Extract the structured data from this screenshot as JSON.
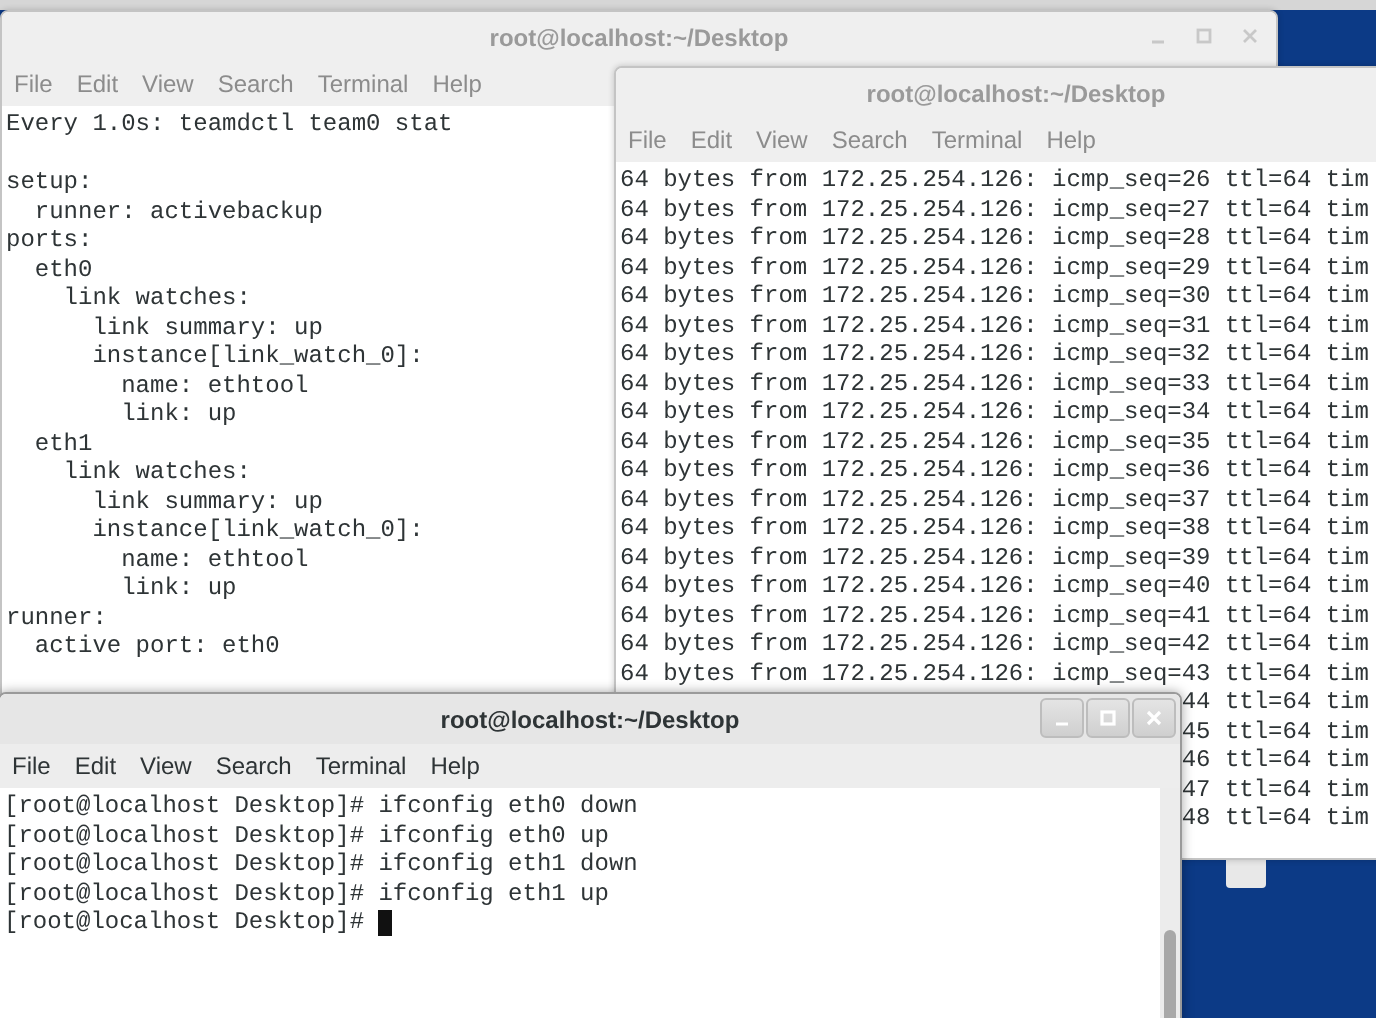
{
  "windows": [
    {
      "title": "root@localhost:~/Desktop",
      "active": false,
      "controls": [
        {
          "kind": "minimize"
        },
        {
          "kind": "maximize"
        },
        {
          "kind": "close"
        }
      ],
      "menu": [
        "File",
        "Edit",
        "View",
        "Search",
        "Terminal",
        "Help"
      ],
      "lines": [
        {
          "kind": "full",
          "text": "Every 1.0s: teamdctl team0 stat"
        },
        {
          "kind": "blank"
        },
        {
          "kind": "full",
          "text": "setup:"
        },
        {
          "kind": "full",
          "text": "  runner: activebackup"
        },
        {
          "kind": "full",
          "text": "ports:"
        },
        {
          "kind": "full",
          "text": "  eth0"
        },
        {
          "kind": "full",
          "text": "    link watches:"
        },
        {
          "kind": "full",
          "text": "      link summary: up"
        },
        {
          "kind": "full",
          "text": "      instance[link_watch_0]:"
        },
        {
          "kind": "full",
          "text": "        name: ethtool"
        },
        {
          "kind": "full",
          "text": "        link: up"
        },
        {
          "kind": "full",
          "text": "  eth1"
        },
        {
          "kind": "full",
          "text": "    link watches:"
        },
        {
          "kind": "full",
          "text": "      link summary: up"
        },
        {
          "kind": "full",
          "text": "      instance[link_watch_0]:"
        },
        {
          "kind": "full",
          "text": "        name: ethtool"
        },
        {
          "kind": "full",
          "text": "        link: up"
        },
        {
          "kind": "full",
          "text": "runner:"
        },
        {
          "kind": "full",
          "text": "  active port: eth0"
        }
      ],
      "cursor": false
    },
    {
      "title": "root@localhost:~/Desktop",
      "active": false,
      "menu": [
        "File",
        "Edit",
        "View",
        "Search",
        "Terminal",
        "Help"
      ],
      "lines": [
        {
          "kind": "full",
          "text": "64 bytes from 172.25.254.126: icmp_seq=26 ttl=64 tim"
        },
        {
          "kind": "full",
          "text": "64 bytes from 172.25.254.126: icmp_seq=27 ttl=64 tim"
        },
        {
          "kind": "full",
          "text": "64 bytes from 172.25.254.126: icmp_seq=28 ttl=64 tim"
        },
        {
          "kind": "full",
          "text": "64 bytes from 172.25.254.126: icmp_seq=29 ttl=64 tim"
        },
        {
          "kind": "full",
          "text": "64 bytes from 172.25.254.126: icmp_seq=30 ttl=64 tim"
        },
        {
          "kind": "full",
          "text": "64 bytes from 172.25.254.126: icmp_seq=31 ttl=64 tim"
        },
        {
          "kind": "full",
          "text": "64 bytes from 172.25.254.126: icmp_seq=32 ttl=64 tim"
        },
        {
          "kind": "full",
          "text": "64 bytes from 172.25.254.126: icmp_seq=33 ttl=64 tim"
        },
        {
          "kind": "full",
          "text": "64 bytes from 172.25.254.126: icmp_seq=34 ttl=64 tim"
        },
        {
          "kind": "full",
          "text": "64 bytes from 172.25.254.126: icmp_seq=35 ttl=64 tim"
        },
        {
          "kind": "full",
          "text": "64 bytes from 172.25.254.126: icmp_seq=36 ttl=64 tim"
        },
        {
          "kind": "full",
          "text": "64 bytes from 172.25.254.126: icmp_seq=37 ttl=64 tim"
        },
        {
          "kind": "full",
          "text": "64 bytes from 172.25.254.126: icmp_seq=38 ttl=64 tim"
        },
        {
          "kind": "full",
          "text": "64 bytes from 172.25.254.126: icmp_seq=39 ttl=64 tim"
        },
        {
          "kind": "full",
          "text": "64 bytes from 172.25.254.126: icmp_seq=40 ttl=64 tim"
        },
        {
          "kind": "full",
          "text": "64 bytes from 172.25.254.126: icmp_seq=41 ttl=64 tim"
        },
        {
          "kind": "full",
          "text": "64 bytes from 172.25.254.126: icmp_seq=42 ttl=64 tim"
        },
        {
          "kind": "full",
          "text": "64 bytes from 172.25.254.126: icmp_seq=43 ttl=64 tim"
        },
        {
          "kind": "partial",
          "text": "44 ttl=64 tim"
        },
        {
          "kind": "partial",
          "text": "45 ttl=64 tim"
        },
        {
          "kind": "partial",
          "text": "46 ttl=64 tim"
        },
        {
          "kind": "partial",
          "text": "47 ttl=64 tim"
        },
        {
          "kind": "partial",
          "text": "48 ttl=64 tim"
        }
      ],
      "cursor": false
    },
    {
      "title": "root@localhost:~/Desktop",
      "active": true,
      "controls": [
        {
          "kind": "minimize"
        },
        {
          "kind": "maximize"
        },
        {
          "kind": "close"
        }
      ],
      "menu": [
        "File",
        "Edit",
        "View",
        "Search",
        "Terminal",
        "Help"
      ],
      "lines": [
        {
          "kind": "full",
          "text": "[root@localhost Desktop]# ifconfig eth0 down"
        },
        {
          "kind": "full",
          "text": "[root@localhost Desktop]# ifconfig eth0 up"
        },
        {
          "kind": "full",
          "text": "[root@localhost Desktop]# ifconfig eth1 down"
        },
        {
          "kind": "full",
          "text": "[root@localhost Desktop]# ifconfig eth1 up"
        },
        {
          "kind": "full",
          "text": "[root@localhost Desktop]# "
        }
      ],
      "cursor": true
    }
  ]
}
